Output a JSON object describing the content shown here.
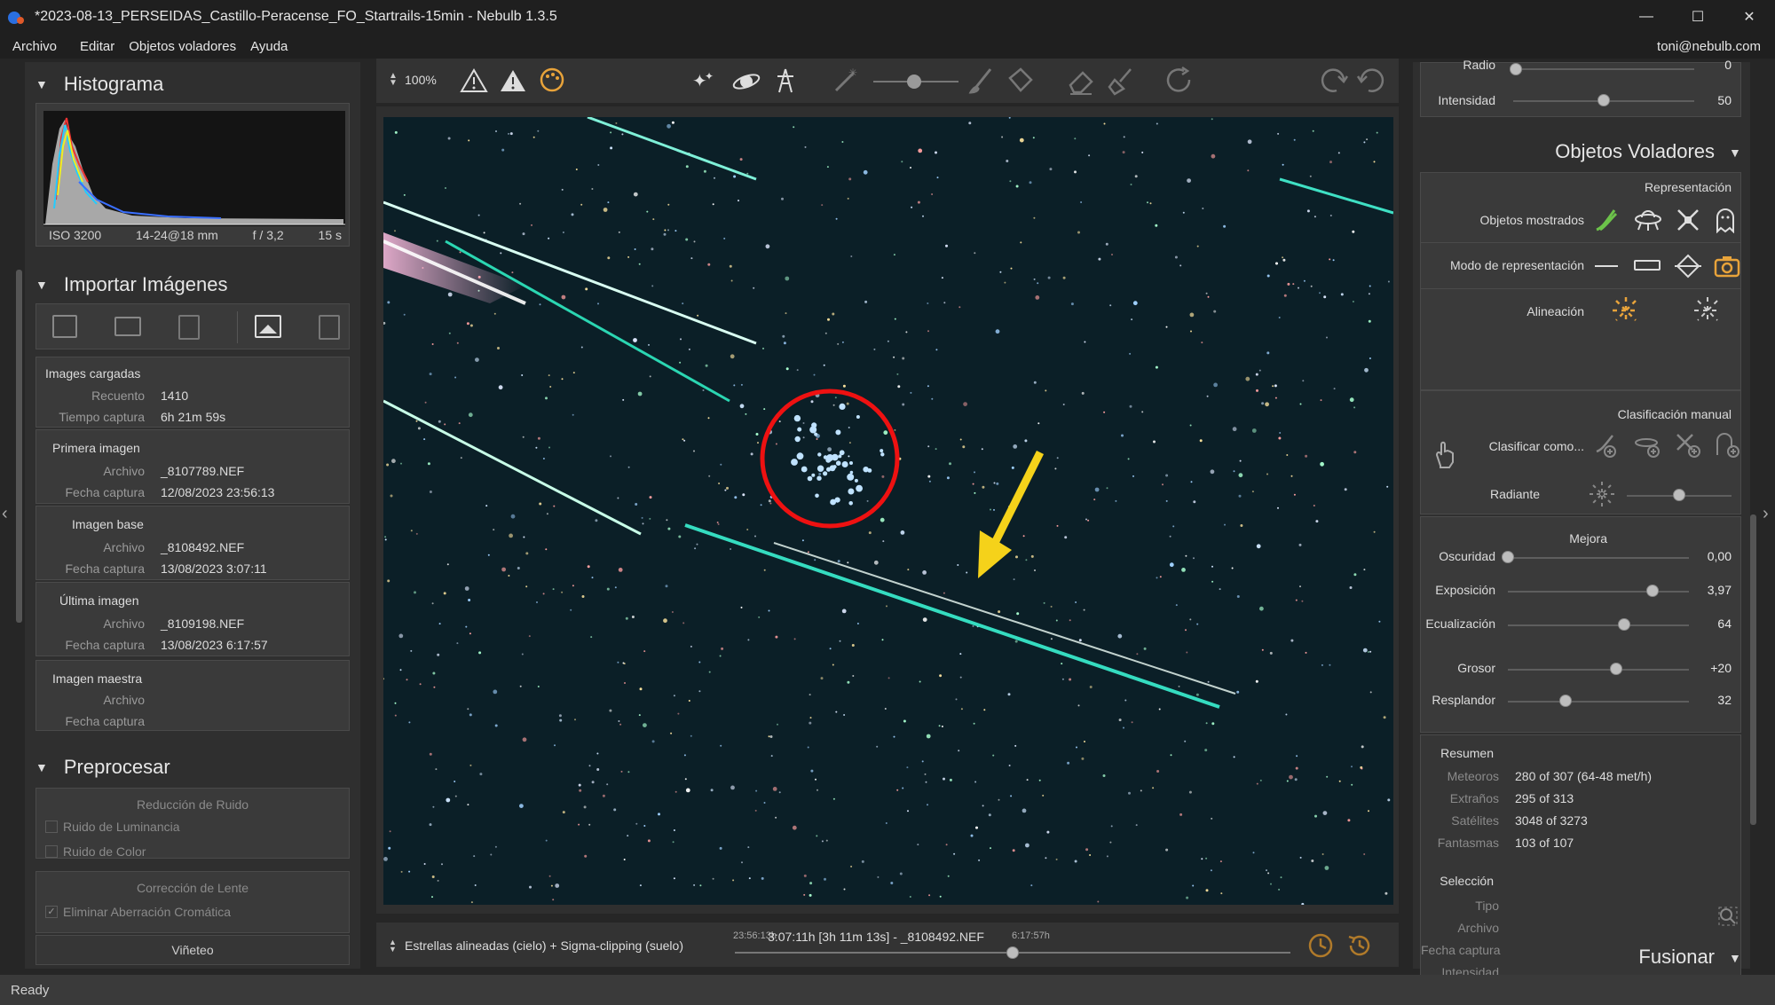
{
  "window": {
    "title": "*2023-08-13_PERSEIDAS_Castillo-Peracense_FO_Startrails-15min - Nebulb 1.3.5",
    "minimize": "—",
    "maximize": "☐",
    "close": "✕"
  },
  "menu": {
    "items": [
      "Archivo",
      "Editar",
      "Objetos voladores",
      "Ayuda"
    ],
    "user": "toni@nebulb.com"
  },
  "histogram": {
    "title": "Histograma",
    "iso": "ISO 3200",
    "lens": "14-24@18 mm",
    "aperture": "f / 3,2",
    "exposure": "15 s"
  },
  "import": {
    "title": "Importar Imágenes",
    "loaded": {
      "header": "Images cargadas",
      "count_label": "Recuento",
      "count": "1410",
      "time_label": "Tiempo captura",
      "time": "6h 21m 59s"
    },
    "first": {
      "header": "Primera imagen",
      "file_label": "Archivo",
      "file": "_8107789.NEF",
      "date_label": "Fecha captura",
      "date": "12/08/2023 23:56:13"
    },
    "base": {
      "header": "Imagen base",
      "file_label": "Archivo",
      "file": "_8108492.NEF",
      "date_label": "Fecha captura",
      "date": "13/08/2023 3:07:11"
    },
    "last": {
      "header": "Última imagen",
      "file_label": "Archivo",
      "file": "_8109198.NEF",
      "date_label": "Fecha captura",
      "date": "13/08/2023 6:17:57"
    },
    "master": {
      "header": "Imagen maestra",
      "file_label": "Archivo",
      "date_label": "Fecha captura"
    }
  },
  "preprocess": {
    "title": "Preprocesar",
    "noise_header": "Reducción de Ruido",
    "luminance": "Ruido de Luminancia",
    "color": "Ruido de Color",
    "lens_header": "Corrección de Lente",
    "chromatic": "Eliminar Aberración Cromática",
    "chromatic_checked": true,
    "vignette": "Viñeteo"
  },
  "toolbar": {
    "zoom": "100%"
  },
  "bottom": {
    "mode": "Estrellas alineadas (cielo) + Sigma-clipping (suelo)",
    "start_time": "23:56:13h",
    "current": "3:07:11h [3h 11m 13s] - _8108492.NEF",
    "end_time": "6:17:57h",
    "timeline_position": 0.5
  },
  "right": {
    "radio_label": "Radio",
    "radio_value": "0",
    "intensidad_label": "Intensidad",
    "intensidad_value": "50",
    "intensidad_pos": 0.5,
    "flying_title": "Objetos Voladores",
    "representacion": "Representación",
    "objetos_mostrados": "Objetos mostrados",
    "modo_representacion": "Modo de representación",
    "alineacion": "Alineación",
    "clasificacion_manual": "Clasificación manual",
    "clasificar_como": "Clasificar como...",
    "radiante": "Radiante",
    "radiante_pos": 0.5,
    "mejora": "Mejora",
    "sliders": [
      {
        "label": "Oscuridad",
        "value": "0,00",
        "pos": 0.0
      },
      {
        "label": "Exposición",
        "value": "3,97",
        "pos": 0.8
      },
      {
        "label": "Ecualización",
        "value": "64",
        "pos": 0.64
      },
      {
        "label": "Grosor",
        "value": "+20",
        "pos": 0.6
      },
      {
        "label": "Resplandor",
        "value": "32",
        "pos": 0.32
      }
    ],
    "resumen": "Resumen",
    "summary": [
      {
        "label": "Meteoros",
        "value": "280 of 307 (64-48 met/h)"
      },
      {
        "label": "Extraños",
        "value": "295 of 313"
      },
      {
        "label": "Satélites",
        "value": "3048 of 3273"
      },
      {
        "label": "Fantasmas",
        "value": "103 of 107"
      }
    ],
    "seleccion": "Selección",
    "selection_labels": [
      "Tipo",
      "Archivo",
      "Fecha captura",
      "Intensidad"
    ],
    "fusionar": "Fusionar"
  },
  "status": "Ready",
  "colors": {
    "accent_orange": "#e8a33a",
    "accent_green": "#6cc24a",
    "annotation_red": "#e11",
    "annotation_yellow": "#f5d21a"
  }
}
